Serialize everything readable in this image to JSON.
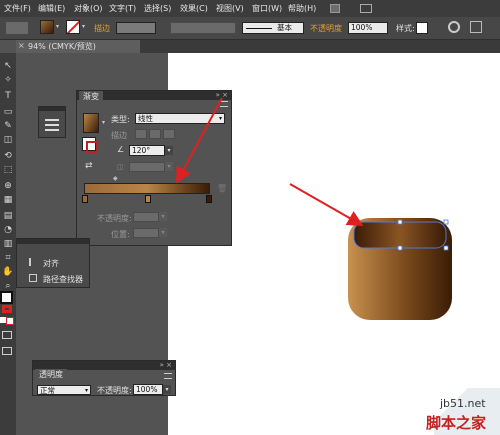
{
  "menu": {
    "items": [
      "文件(F)",
      "编辑(E)",
      "对象(O)",
      "文字(T)",
      "选择(S)",
      "效果(C)",
      "视图(V)",
      "窗口(W)",
      "帮助(H)"
    ]
  },
  "options": {
    "stroke_label": "描边",
    "stroke_style": "基本",
    "opacity_label": "不透明度",
    "opacity_value": "100%",
    "style_label": "样式:"
  },
  "document": {
    "tab_label": "94% (CMYK/预览)"
  },
  "gradient_panel": {
    "title": "渐变",
    "type_label": "类型:",
    "type_value": "线性",
    "stroke_label": "描边",
    "angle_value": "120°",
    "opacity_label": "不透明度:",
    "location_label": "位置:",
    "colors": {
      "start": "#9a6a3a",
      "mid": "#b98547",
      "end": "#3a1c06"
    }
  },
  "align_panel": {
    "items": [
      "对齐",
      "路径查找器"
    ]
  },
  "transparency_panel": {
    "title": "透明度",
    "mode_value": "正常",
    "opacity_label": "不透明度:",
    "opacity_value": "100%"
  },
  "watermark": {
    "line1": "jb51.net",
    "line2": "脚本之家"
  },
  "colors": {
    "annotation_arrow": "#e02020",
    "menu_bg": "#3c3c3c",
    "panel_bg": "#535353"
  }
}
